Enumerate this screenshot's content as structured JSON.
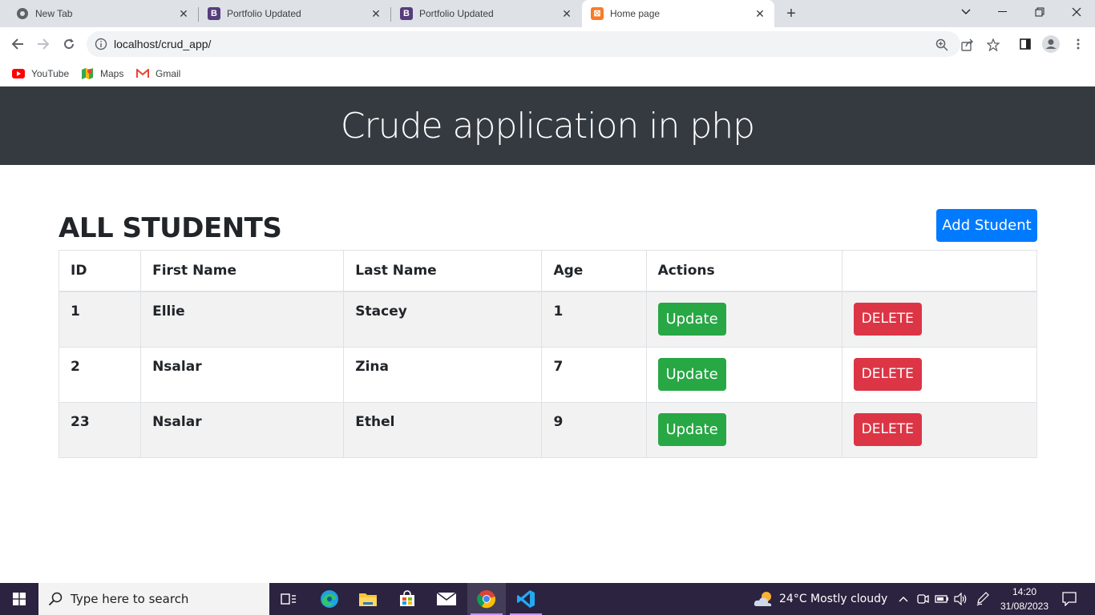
{
  "browser": {
    "tabs": [
      {
        "title": "New Tab",
        "icon": "chrome-icon",
        "active": false
      },
      {
        "title": "Portfolio Updated",
        "icon": "bootstrap-icon",
        "active": false
      },
      {
        "title": "Portfolio Updated",
        "icon": "bootstrap-icon",
        "active": false
      },
      {
        "title": "Home page",
        "icon": "xampp-icon",
        "active": true
      }
    ],
    "url": "localhost/crud_app/",
    "bookmarks": [
      {
        "label": "YouTube",
        "icon": "youtube-icon"
      },
      {
        "label": "Maps",
        "icon": "maps-icon"
      },
      {
        "label": "Gmail",
        "icon": "gmail-icon"
      }
    ]
  },
  "page": {
    "header_title": "Crude application in php",
    "section_title": "ALL STUDENTS",
    "add_button": "Add Student",
    "table": {
      "headers": [
        "ID",
        "First Name",
        "Last Name",
        "Age",
        "Actions",
        ""
      ],
      "rows": [
        {
          "id": "1",
          "first_name": "Ellie",
          "last_name": "Stacey",
          "age": "1",
          "update_label": "Update",
          "delete_label": "DELETE"
        },
        {
          "id": "2",
          "first_name": "Nsalar",
          "last_name": "Zina",
          "age": "7",
          "update_label": "Update",
          "delete_label": "DELETE"
        },
        {
          "id": "23",
          "first_name": "Nsalar",
          "last_name": "Ethel",
          "age": "9",
          "update_label": "Update",
          "delete_label": "DELETE"
        }
      ]
    }
  },
  "taskbar": {
    "search_placeholder": "Type here to search",
    "weather": "24°C  Mostly cloudy",
    "time": "14:20",
    "date": "31/08/2023"
  },
  "colors": {
    "header_bg": "#343a40",
    "primary": "#007bff",
    "success": "#28a745",
    "danger": "#dc3545"
  }
}
